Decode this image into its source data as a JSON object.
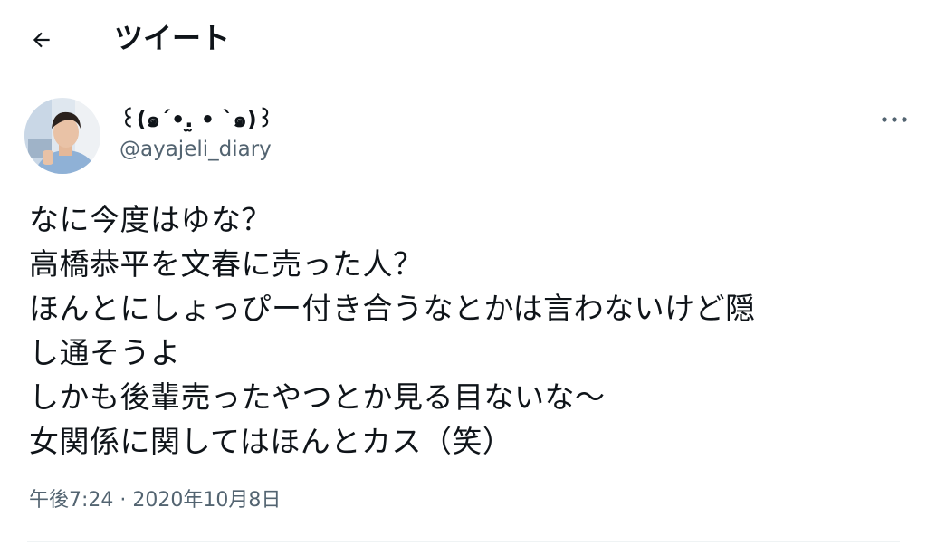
{
  "header": {
    "back_icon": "arrow-left-icon",
    "title": "ツイート"
  },
  "author": {
    "display_name": "꒰(๑´•.̫ • `๑)꒱",
    "handle": "@ayajeli_diary",
    "more_icon": "ellipsis-horizontal-icon"
  },
  "tweet": {
    "lines": [
      "なに今度はゆな？",
      "高橋恭平を文春に売った人？",
      "ほんとにしょっぴー付き合うなとかは言わないけど隠",
      "し通そうよ",
      "しかも後輩売ったやつとか見る目ないな〜",
      "女関係に関してはほんとカス（笑）"
    ]
  },
  "meta": {
    "time": "午後7:24",
    "separator": " · ",
    "date": "2020年10月8日"
  },
  "colors": {
    "text_primary": "#0f1419",
    "text_secondary": "#536471",
    "divider": "#eff3f4"
  }
}
